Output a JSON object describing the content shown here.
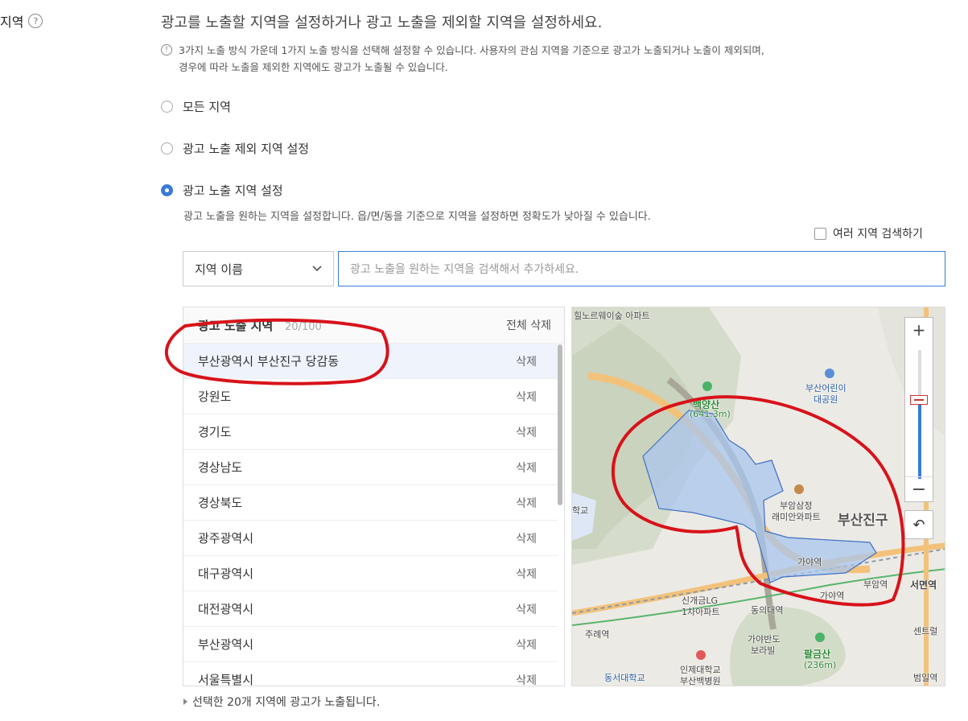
{
  "section": {
    "label": "지역",
    "help_icon": "?"
  },
  "heading": "광고를 노출할 지역을 설정하거나 광고 노출을 제외할 지역을 설정하세요.",
  "notice": {
    "icon": "!",
    "line1": "3가지 노출 방식 가운데 1가지 노출 방식을 선택해 설정할 수 있습니다. 사용자의 관심 지역을 기준으로 광고가 노출되거나 노출이 제외되며,",
    "line2": "경우에 따라 노출을 제외한 지역에도 광고가 노출될 수 있습니다."
  },
  "options": [
    {
      "label": "모든 지역",
      "selected": false
    },
    {
      "label": "광고 노출 제외 지역 설정",
      "selected": false
    },
    {
      "label": "광고 노출 지역 설정",
      "selected": true
    }
  ],
  "option_desc": "광고 노출을 원하는 지역을 설정합니다. 읍/면/동을 기준으로 지역을 설정하면 정확도가 낮아질 수 있습니다.",
  "multi_search": {
    "label": "여러 지역 검색하기",
    "checked": false
  },
  "select": {
    "value": "지역 이름"
  },
  "search": {
    "placeholder": "광고 노출을 원하는 지역을 검색해서 추가하세요."
  },
  "list": {
    "title": "광고 노출 지역",
    "count": "20/100",
    "delete_all": "전체 삭제",
    "delete_label": "삭제",
    "items": [
      "부산광역시 부산진구 당감동",
      "강원도",
      "경기도",
      "경상남도",
      "경상북도",
      "광주광역시",
      "대구광역시",
      "대전광역시",
      "부산광역시",
      "서울특별시"
    ]
  },
  "map": {
    "zoom_in": "+",
    "zoom_out": "−",
    "reset": "↶",
    "labels": {
      "apt": "힐노르웨이숲 아파트",
      "mountain": "백양산",
      "mountain_h": "(641.3m)",
      "park1": "부산어린이",
      "park2": "대공원",
      "apt2a": "부암삼정",
      "apt2b": "래미안와파트",
      "district": "부산진구",
      "gaya1": "가야역",
      "gaya2": "가야역",
      "buam": "부암역",
      "seomyeon": "서면역",
      "sinkae1": "신개금LG",
      "sinkae2": "1차아파트",
      "dongeui": "동의대역",
      "jurye": "주례역",
      "gayaban1": "가야반도",
      "gayaban2": "보라빌",
      "palgeum": "팔금산",
      "palgeum_h": "(236m)",
      "dongseo": "동서대학교",
      "inje1": "인제대학교",
      "inje2": "부산백병원",
      "school": "학교",
      "beomil": "범일역",
      "center": "센트럴"
    }
  },
  "footer": "선택한 20개 지역에 광고가 노출됩니다."
}
